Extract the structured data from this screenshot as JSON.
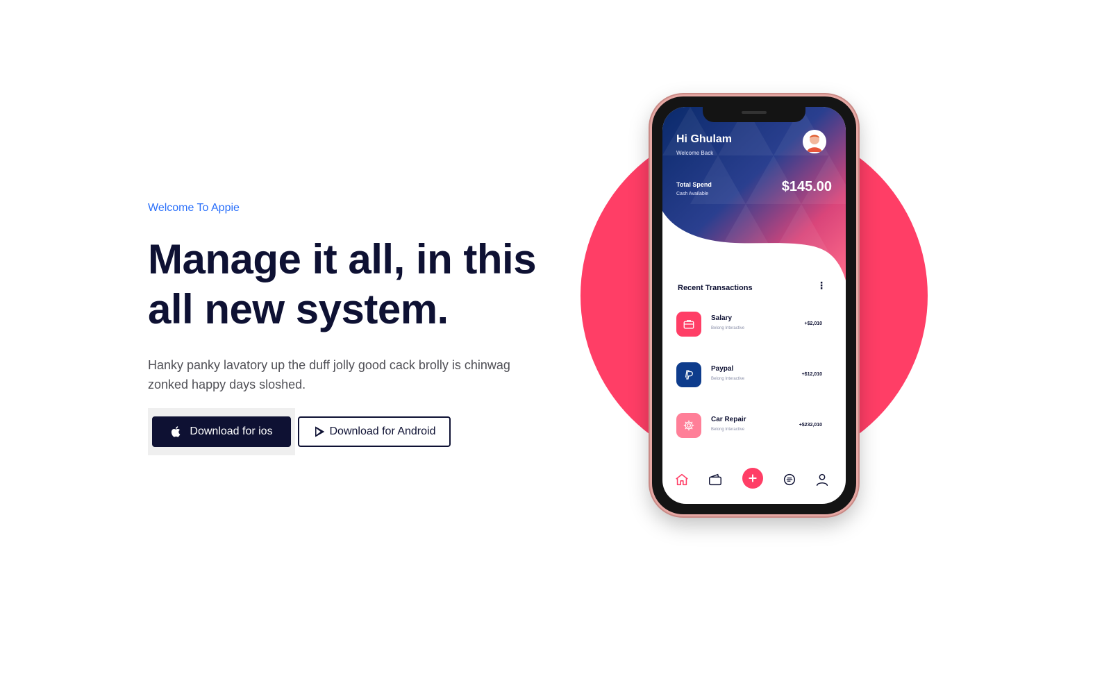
{
  "hero": {
    "eyebrow": "Welcome To Appie",
    "headline_line1": "Manage it all, in this",
    "headline_line2": "all new system.",
    "description_line1": "Hanky panky lavatory up the duff jolly good cack brolly is chinwag",
    "description_line2": "zonked happy days sloshed.",
    "buttons": {
      "ios_label": "Download for ios",
      "android_label": "Download for Android"
    }
  },
  "phone": {
    "greeting": "Hi Ghulam",
    "greeting_sub": "Welcome Back",
    "total_spend_label": "Total Spend",
    "cash_available_label": "Cash Available",
    "total_spend_amount": "$145.00",
    "recent_title": "Recent Transactions",
    "transactions": [
      {
        "name": "Salary",
        "sub": "Belong Interactive",
        "amount": "+$2,010",
        "icon": "briefcase-icon",
        "color": "#ff3e66"
      },
      {
        "name": "Paypal",
        "sub": "Belong Interactive",
        "amount": "+$12,010",
        "icon": "paypal-icon",
        "color": "#0e3c8c"
      },
      {
        "name": "Car Repair",
        "sub": "Belong Interactive",
        "amount": "+$232,010",
        "icon": "gear-icon",
        "color": "#ff7f98"
      }
    ],
    "bottom_nav": [
      "home-icon",
      "wallet-icon",
      "add-icon",
      "chat-icon",
      "user-icon"
    ]
  },
  "colors": {
    "accent": "#ff3e66",
    "brand_blue": "#2b70fa",
    "dark": "#0e1133",
    "phone_gradient_start": "#0a2a6b",
    "phone_gradient_end": "#ff5a7f"
  }
}
